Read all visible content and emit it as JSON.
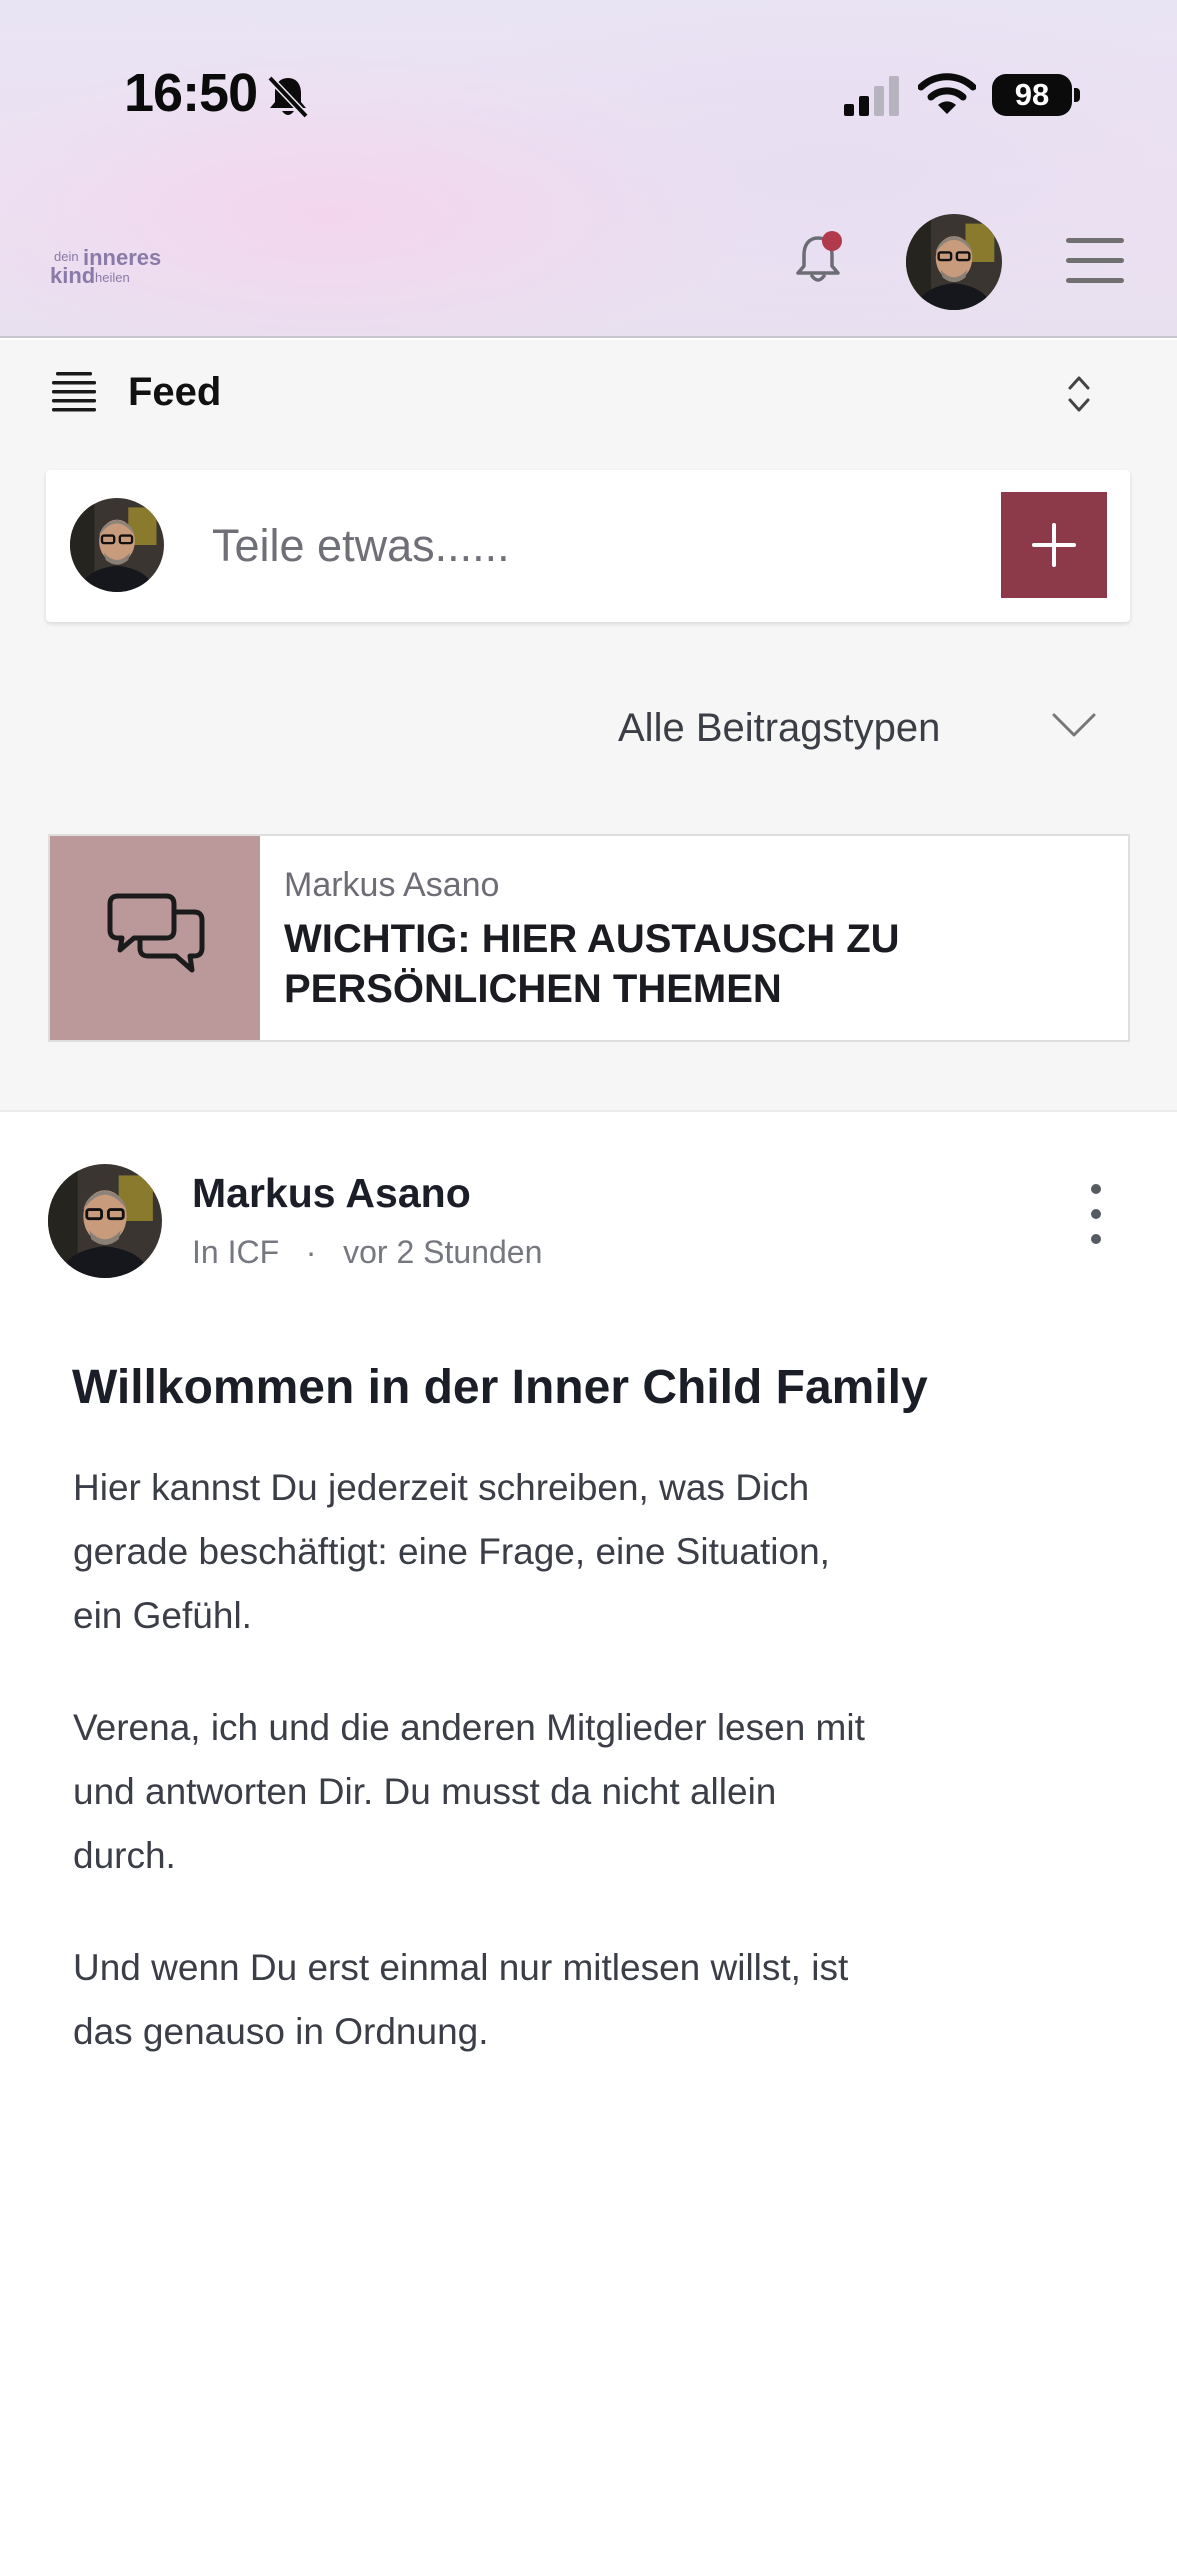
{
  "status_bar": {
    "time": "16:50",
    "battery": "98",
    "icons": [
      "bell-off-icon",
      "signal-icon",
      "wifi-icon",
      "battery-icon"
    ]
  },
  "header": {
    "logo": {
      "line1": "dein",
      "line1_bold": "inneres",
      "line2": "kind",
      "line2_light": "heilen"
    },
    "icons": [
      "notification-bell-icon",
      "avatar",
      "hamburger-menu-icon"
    ],
    "colors": {
      "notification_dot": "#b13a4c",
      "logo": "#8a7aa8"
    }
  },
  "feed": {
    "title": "Feed",
    "composer_placeholder": "Teile etwas......",
    "filter_label": "Alle Beitragstypen",
    "colors": {
      "accent": "#8c3a4a",
      "pinned_tile": "#bb999b"
    }
  },
  "pinned_post": {
    "author": "Markus Asano",
    "title": "WICHTIG: HIER AUSTAUSCH ZU PERSÖNLICHEN THEMEN"
  },
  "post": {
    "author": "Markus Asano",
    "group": "In ICF",
    "separator": "·",
    "time": "vor 2 Stunden",
    "title": "Willkommen in der Inner Child Family",
    "paragraphs": [
      "Hier kannst Du jederzeit schreiben, was Dich gerade beschäftigt: eine Frage, eine Situation, ein Gefühl.",
      "Verena, ich und die anderen Mitglieder lesen mit und antworten Dir. Du musst da nicht allein durch.",
      "Und wenn Du erst einmal nur mitlesen willst, ist das genauso in Ordnung."
    ]
  }
}
